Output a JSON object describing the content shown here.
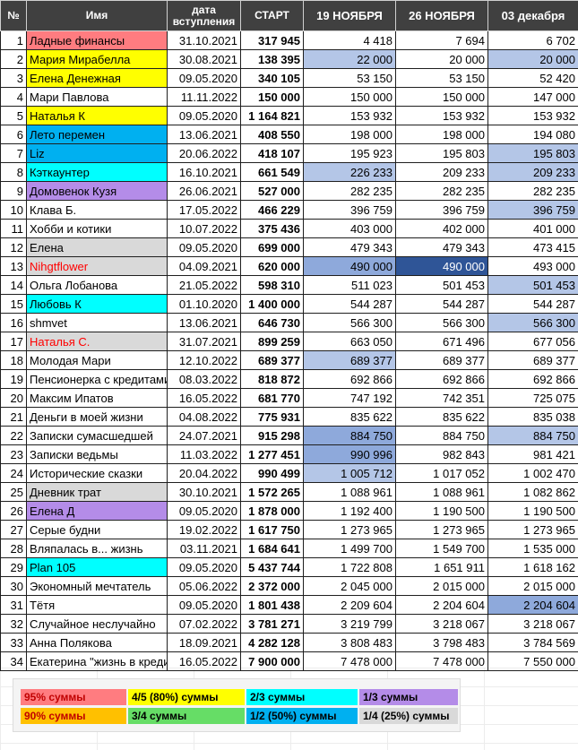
{
  "colors": {
    "pink": "#ff7c80",
    "yellow": "#ffff00",
    "blue": "#00b0f0",
    "cyan": "#00ffff",
    "purple": "#b48ce8",
    "gray": "#d9d9d9",
    "lightblue": "#b4c6e7",
    "midblue": "#8ea9db",
    "darkblue": "#2f5597",
    "red_text": "#ff0000",
    "orange": "#ffc000",
    "green": "#66dd66"
  },
  "header": {
    "num": "№",
    "name": "Имя",
    "date": "дата вступления",
    "start": "СТАРТ",
    "col1": "19 НОЯБРЯ",
    "col2": "26 НОЯБРЯ",
    "col3": "03 декабря"
  },
  "rows": [
    {
      "n": "1",
      "name": "Ладные финансы",
      "date": "31.10.2021",
      "start": "317 945",
      "v1": "4 418",
      "v2": "7 694",
      "v3": "6 702",
      "nameBg": "pink"
    },
    {
      "n": "2",
      "name": "Мария Мирабелла",
      "date": "30.08.2021",
      "start": "138 395",
      "v1": "22 000",
      "v2": "20 000",
      "v3": "20 000",
      "nameBg": "yellow",
      "b1": "lightblue",
      "b3": "lightblue"
    },
    {
      "n": "3",
      "name": "Елена Денежная",
      "date": "09.05.2020",
      "start": "340 105",
      "v1": "53 150",
      "v2": "53 150",
      "v3": "52 420",
      "nameBg": "yellow"
    },
    {
      "n": "4",
      "name": "Мари Павлова",
      "date": "11.11.2022",
      "start": "150 000",
      "v1": "150 000",
      "v2": "150 000",
      "v3": "147 000"
    },
    {
      "n": "5",
      "name": "Наталья К",
      "date": "09.05.2020",
      "start": "1 164 821",
      "v1": "153 932",
      "v2": "153 932",
      "v3": "153 932",
      "nameBg": "yellow"
    },
    {
      "n": "6",
      "name": "Лето перемен",
      "date": "13.06.2021",
      "start": "408 550",
      "v1": "198 000",
      "v2": "198 000",
      "v3": "194 080",
      "nameBg": "blue"
    },
    {
      "n": "7",
      "name": "Liz",
      "date": "20.06.2022",
      "start": "418 107",
      "v1": "195 923",
      "v2": "195 803",
      "v3": "195 803",
      "nameBg": "blue",
      "b3": "lightblue"
    },
    {
      "n": "8",
      "name": "Кэткаунтер",
      "date": "16.10.2021",
      "start": "661 549",
      "v1": "226 233",
      "v2": "209 233",
      "v3": "209 233",
      "nameBg": "cyan",
      "b1": "lightblue",
      "b3": "lightblue"
    },
    {
      "n": "9",
      "name": "Домовенок Кузя",
      "date": "26.06.2021",
      "start": "527 000",
      "v1": "282 235",
      "v2": "282 235",
      "v3": "282 235",
      "nameBg": "purple"
    },
    {
      "n": "10",
      "name": "Клава Б.",
      "date": "17.05.2022",
      "start": "466 229",
      "v1": "396 759",
      "v2": "396 759",
      "v3": "396 759",
      "b3": "lightblue"
    },
    {
      "n": "11",
      "name": "Хобби и котики",
      "date": "10.07.2022",
      "start": "375 436",
      "v1": "403 000",
      "v2": "402 000",
      "v3": "401 000"
    },
    {
      "n": "12",
      "name": "Елена",
      "date": "09.05.2020",
      "start": "699 000",
      "v1": "479 343",
      "v2": "479 343",
      "v3": "473 415",
      "nameBg": "gray"
    },
    {
      "n": "13",
      "name": "Nihgtflower",
      "date": "04.09.2021",
      "start": "620 000",
      "v1": "490 000",
      "v2": "490 000",
      "v3": "493 000",
      "nameBg": "gray",
      "nameRed": true,
      "b1": "midblue",
      "b2": "darkblue"
    },
    {
      "n": "14",
      "name": "Ольга Лобанова",
      "date": "21.05.2022",
      "start": "598 310",
      "v1": "511 023",
      "v2": "501 453",
      "v3": "501 453",
      "b3": "lightblue"
    },
    {
      "n": "15",
      "name": "Любовь К",
      "date": "01.10.2020",
      "start": "1 400 000",
      "v1": "544 287",
      "v2": "544 287",
      "v3": "544 287",
      "nameBg": "cyan"
    },
    {
      "n": "16",
      "name": "shmvet",
      "date": "13.06.2021",
      "start": "646 730",
      "v1": "566 300",
      "v2": "566 300",
      "v3": "566 300",
      "b3": "lightblue"
    },
    {
      "n": "17",
      "name": "Наталья С.",
      "date": "31.07.2021",
      "start": "899 259",
      "v1": "663 050",
      "v2": "671 496",
      "v3": "677 056",
      "nameBg": "gray",
      "nameRed": true
    },
    {
      "n": "18",
      "name": "Молодая Мари",
      "date": "12.10.2022",
      "start": "689 377",
      "v1": "689 377",
      "v2": "689 377",
      "v3": "689 377",
      "b1": "lightblue"
    },
    {
      "n": "19",
      "name": "Пенсионерка с кредитами",
      "date": "08.03.2022",
      "start": "818 872",
      "v1": "692 866",
      "v2": "692 866",
      "v3": "692 866"
    },
    {
      "n": "20",
      "name": "Максим Ипатов",
      "date": "16.05.2022",
      "start": "681 770",
      "v1": "747 192",
      "v2": "742 351",
      "v3": "725 075"
    },
    {
      "n": "21",
      "name": "Деньги в моей жизни",
      "date": "04.08.2022",
      "start": "775 931",
      "v1": "835 622",
      "v2": "835 622",
      "v3": "835 038"
    },
    {
      "n": "22",
      "name": "Записки сумасшедшей",
      "date": "24.07.2021",
      "start": "915 298",
      "v1": "884 750",
      "v2": "884 750",
      "v3": "884 750",
      "b1": "midblue",
      "b3": "lightblue"
    },
    {
      "n": "23",
      "name": "Записки ведьмы",
      "date": "11.03.2022",
      "start": "1 277 451",
      "v1": "990 996",
      "v2": "982 843",
      "v3": "981 421",
      "b1": "midblue"
    },
    {
      "n": "24",
      "name": "Исторические сказки",
      "date": "20.04.2022",
      "start": "990 499",
      "v1": "1 005 712",
      "v2": "1 017 052",
      "v3": "1 002 470",
      "b1": "lightblue"
    },
    {
      "n": "25",
      "name": "Дневник трат",
      "date": "30.10.2021",
      "start": "1 572 265",
      "v1": "1 088 961",
      "v2": "1 088 961",
      "v3": "1 082 862",
      "nameBg": "gray"
    },
    {
      "n": "26",
      "name": "Елена Д",
      "date": "09.05.2020",
      "start": "1 878 000",
      "v1": "1 192 400",
      "v2": "1 190 500",
      "v3": "1 190 500",
      "nameBg": "purple"
    },
    {
      "n": "27",
      "name": "Серые будни",
      "date": "19.02.2022",
      "start": "1 617 750",
      "v1": "1 273 965",
      "v2": "1 273 965",
      "v3": "1 273 965"
    },
    {
      "n": "28",
      "name": "Вляпалась в... жизнь",
      "date": "03.11.2021",
      "start": "1 684 641",
      "v1": "1 499 700",
      "v2": "1 549 700",
      "v3": "1 535 000"
    },
    {
      "n": "29",
      "name": "Plan 105",
      "date": "09.05.2020",
      "start": "5 437 744",
      "v1": "1 722 808",
      "v2": "1 651 911",
      "v3": "1 618 162",
      "nameBg": "cyan"
    },
    {
      "n": "30",
      "name": "Экономный мечтатель",
      "date": "05.06.2022",
      "start": "2 372 000",
      "v1": "2 045 000",
      "v2": "2 015 000",
      "v3": "2 015 000"
    },
    {
      "n": "31",
      "name": "Тётя",
      "date": "09.05.2020",
      "start": "1 801 438",
      "v1": "2 209 604",
      "v2": "2 204 604",
      "v3": "2 204 604",
      "b3": "midblue"
    },
    {
      "n": "32",
      "name": "Случайное неслучайно",
      "date": "07.02.2022",
      "start": "3 781 271",
      "v1": "3 219 799",
      "v2": "3 218 067",
      "v3": "3 218 067"
    },
    {
      "n": "33",
      "name": "Анна Полякова",
      "date": "18.09.2021",
      "start": "4 282 128",
      "v1": "3 808 483",
      "v2": "3 798 483",
      "v3": "3 784 569"
    },
    {
      "n": "34",
      "name": "Екатерина \"жизнь в кредит\"",
      "date": "16.05.2022",
      "start": "7 900 000",
      "v1": "7 478 000",
      "v2": "7 478 000",
      "v3": "7 550 000"
    }
  ],
  "legend": [
    [
      {
        "label": "95% суммы",
        "color": "pink",
        "labelRed": true
      },
      {
        "label": "4/5 (80%) суммы",
        "color": "yellow"
      },
      {
        "label": "2/3 суммы",
        "color": "cyan"
      },
      {
        "label": "1/3 суммы",
        "color": "purple"
      }
    ],
    [
      {
        "label": "90% суммы",
        "color": "orange",
        "labelRed": true
      },
      {
        "label": "3/4 суммы",
        "color": "green"
      },
      {
        "label": "1/2 (50%) суммы",
        "color": "blue"
      },
      {
        "label": "1/4 (25%) суммы",
        "color": "gray"
      }
    ]
  ]
}
